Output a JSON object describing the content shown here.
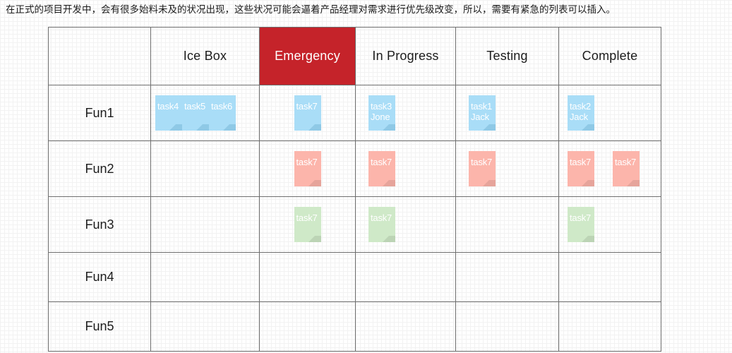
{
  "caption": "在正式的项目开发中，会有很多始料未及的状况出现，这些状况可能会逼着产品经理对需求进行优先级改变，所以，需要有紧急的列表可以插入。",
  "colors": {
    "emergency_header_bg": "#c5232a",
    "card_blue": "#a9ddf7",
    "card_pink": "#fcb5ab",
    "card_green": "#cfe9c8",
    "grid_line": "#6e6e6e"
  },
  "board": {
    "corner_label": "",
    "columns": [
      {
        "key": "icebox",
        "label": "Ice Box",
        "highlight": false
      },
      {
        "key": "emergency",
        "label": "Emergency",
        "highlight": true
      },
      {
        "key": "inprogress",
        "label": "In Progress",
        "highlight": false
      },
      {
        "key": "testing",
        "label": "Testing",
        "highlight": false
      },
      {
        "key": "complete",
        "label": "Complete",
        "highlight": false
      }
    ],
    "rows": [
      {
        "label": "Fun1",
        "cells": {
          "icebox": [
            {
              "title": "task4",
              "owner": "",
              "color": "blue"
            },
            {
              "title": "task5",
              "owner": "",
              "color": "blue"
            },
            {
              "title": "task6",
              "owner": "",
              "color": "blue"
            }
          ],
          "emergency": [
            {
              "title": "task7",
              "owner": "",
              "color": "blue"
            }
          ],
          "inprogress": [
            {
              "title": "task3",
              "owner": "Jone",
              "color": "blue"
            }
          ],
          "testing": [
            {
              "title": "task1",
              "owner": "Jack",
              "color": "blue"
            }
          ],
          "complete": [
            {
              "title": "task2",
              "owner": "Jack",
              "color": "blue"
            }
          ]
        }
      },
      {
        "label": "Fun2",
        "cells": {
          "icebox": [],
          "emergency": [
            {
              "title": "task7",
              "owner": "",
              "color": "pink"
            }
          ],
          "inprogress": [
            {
              "title": "task7",
              "owner": "",
              "color": "pink"
            }
          ],
          "testing": [
            {
              "title": "task7",
              "owner": "",
              "color": "pink"
            }
          ],
          "complete": [
            {
              "title": "task7",
              "owner": "",
              "color": "pink"
            },
            {
              "title": "task7",
              "owner": "",
              "color": "pink"
            }
          ]
        }
      },
      {
        "label": "Fun3",
        "cells": {
          "icebox": [],
          "emergency": [
            {
              "title": "task7",
              "owner": "",
              "color": "green"
            }
          ],
          "inprogress": [
            {
              "title": "task7",
              "owner": "",
              "color": "green"
            }
          ],
          "testing": [],
          "complete": [
            {
              "title": "task7",
              "owner": "",
              "color": "green"
            }
          ]
        }
      },
      {
        "label": "Fun4",
        "cells": {
          "icebox": [],
          "emergency": [],
          "inprogress": [],
          "testing": [],
          "complete": []
        }
      },
      {
        "label": "Fun5",
        "cells": {
          "icebox": [],
          "emergency": [],
          "inprogress": [],
          "testing": [],
          "complete": []
        }
      }
    ]
  }
}
